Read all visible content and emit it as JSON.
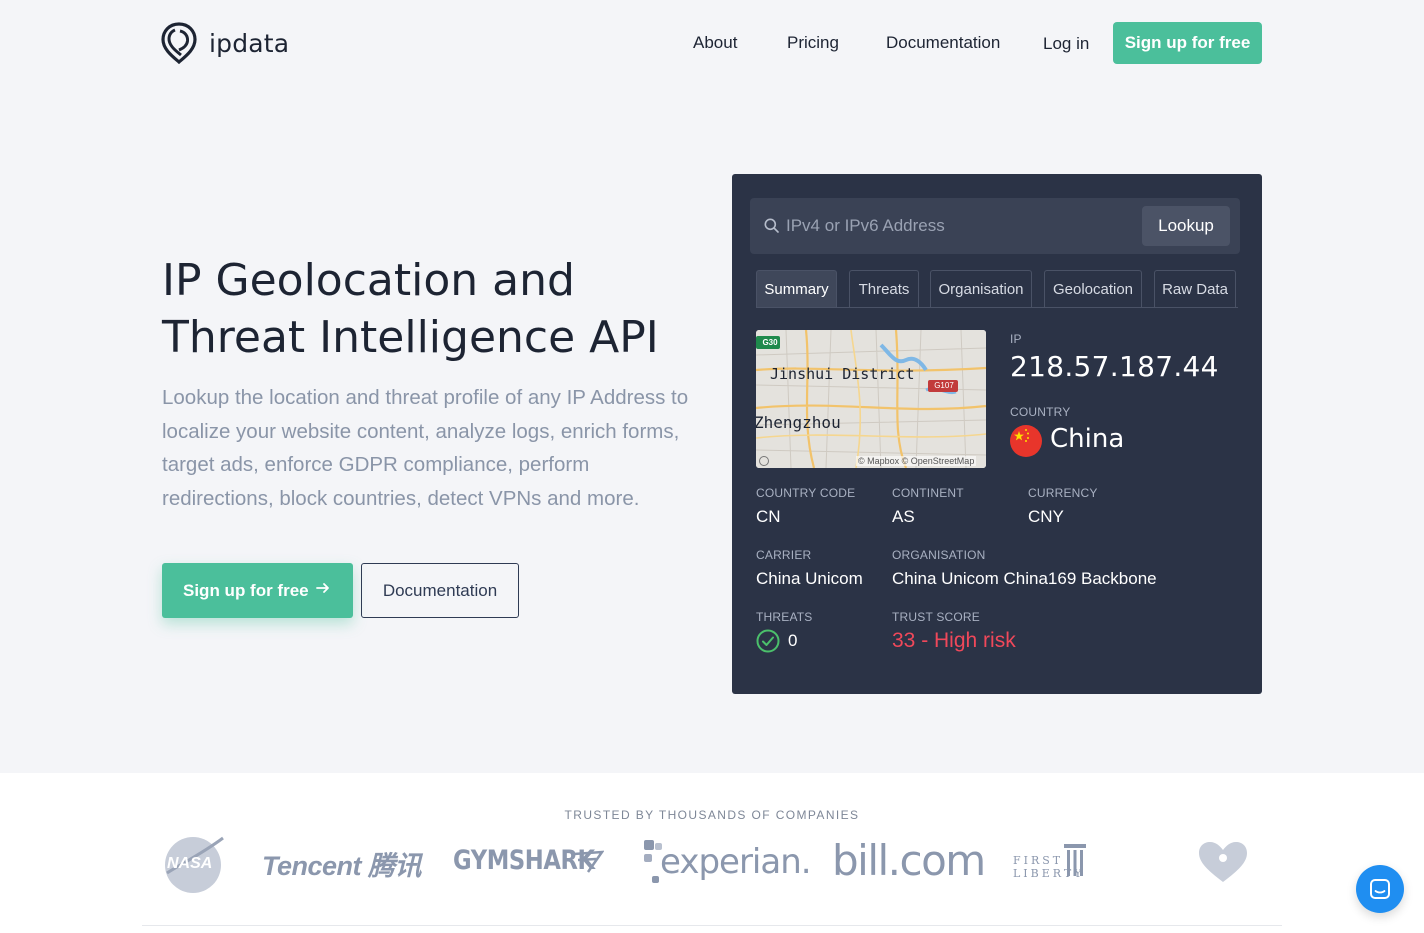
{
  "brand": {
    "name": "ipdata"
  },
  "nav": {
    "about": "About",
    "pricing": "Pricing",
    "documentation": "Documentation",
    "login": "Log in",
    "signup": "Sign up for free"
  },
  "hero": {
    "title_line1": "IP Geolocation and",
    "title_line2": "Threat Intelligence API",
    "description": "Lookup the location and threat profile of any IP Address to localize your website content, analyze logs, enrich forms, target ads, enforce GDPR compliance, perform redirections, block countries, detect VPNs and more.",
    "signup_label": "Sign up for free",
    "docs_label": "Documentation"
  },
  "lookup": {
    "placeholder": "IPv4 or IPv6 Address",
    "button": "Lookup",
    "tabs": [
      "Summary",
      "Threats",
      "Organisation",
      "Geolocation",
      "Raw Data"
    ],
    "active_tab": "Summary",
    "map": {
      "district": "Jinshui District",
      "city": "Zhengzhou",
      "road1": "G30",
      "road2": "G107",
      "credit": "© Mapbox © OpenStreetMap"
    },
    "ip_label": "IP",
    "ip": "218.57.187.44",
    "country_label": "COUNTRY",
    "country": "China",
    "country_code_label": "COUNTRY CODE",
    "country_code": "CN",
    "continent_label": "CONTINENT",
    "continent": "AS",
    "currency_label": "CURRENCY",
    "currency": "CNY",
    "carrier_label": "CARRIER",
    "carrier": "China Unicom",
    "organisation_label": "ORGANISATION",
    "organisation": "China Unicom China169 Backbone",
    "threats_label": "THREATS",
    "threats": "0",
    "trust_label": "TRUST SCORE",
    "trust_score": "33 - High risk"
  },
  "trusted": {
    "title": "TRUSTED BY THOUSANDS OF COMPANIES",
    "companies": [
      "NASA",
      "Tencent 腾讯",
      "GYMSHARK",
      "experian.",
      "bill.com",
      "FIRST LIBERTY",
      "iHeart"
    ]
  },
  "colors": {
    "accent": "#4bbf9b",
    "panel": "#2b3346",
    "risk": "#f0485a",
    "chat": "#1f8ef1"
  }
}
